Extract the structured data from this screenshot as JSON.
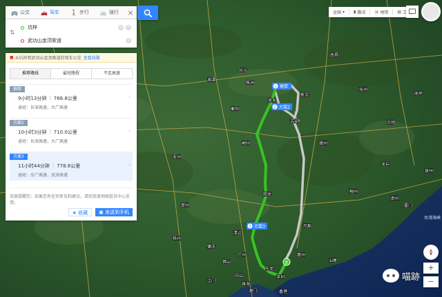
{
  "modebar": {
    "modes": [
      {
        "label": "公交",
        "icon": "bus-icon"
      },
      {
        "label": "驾车",
        "icon": "car-icon"
      },
      {
        "label": "步行",
        "icon": "walk-icon"
      },
      {
        "label": "骑行",
        "icon": "bike-icon"
      }
    ],
    "close": "×"
  },
  "route_inputs": {
    "start": "坑梓",
    "end": "武功山金顶索道",
    "swap_icon": "swap-icon"
  },
  "results": {
    "warning_text": "从坑梓到武功山金顶索道的驾车公交",
    "warning_link": "查看线路",
    "tabs": [
      "推荐路线",
      "最短路程",
      "不走高速"
    ],
    "routes": [
      {
        "label": "推荐",
        "time": "9小时13分钟",
        "distance": "768.8公里",
        "via": "途经：长深高速，大广高速"
      },
      {
        "label": "方案2",
        "time": "10小时3分钟",
        "distance": "710.0公里",
        "via": "途经：长深高速，大广高速"
      },
      {
        "label": "方案3",
        "time": "11小时44分钟",
        "distance": "778.8公里",
        "via": "途经：乐广高速，武深高速"
      }
    ],
    "tip": "百度提醒您：如果您有任何意见和建议，请到百度地图投诉中心反馈。",
    "favorite_label": "收藏",
    "send_label": "发送到手机"
  },
  "toolbar": {
    "city": "全国",
    "layer": "路况",
    "subway": "地铁",
    "tools": "工具"
  },
  "map": {
    "cities": [
      "南昌",
      "长沙",
      "株洲",
      "衡阳",
      "赣州",
      "郴州",
      "韶关",
      "清远",
      "广州",
      "东莞",
      "深圳",
      "香港",
      "澳门",
      "惠州",
      "河源",
      "梅州",
      "龙岩",
      "吉安",
      "萍乡",
      "湘潭",
      "永州",
      "桂林",
      "柳州",
      "贺州",
      "梧州",
      "肇庆",
      "佛山",
      "中山",
      "珠海",
      "江门",
      "汕尾",
      "漳州",
      "厦门",
      "三明",
      "抚州",
      "宜春",
      "新余",
      "南平",
      "泉州"
    ],
    "markers": [
      {
        "num": "1",
        "label": "推荐"
      },
      {
        "num": "2",
        "label": "方案2"
      },
      {
        "num": "3",
        "label": "方案3"
      }
    ],
    "start_marker": "起",
    "sea_label": "台湾海峡"
  },
  "watermark": "喵跡",
  "colors": {
    "accent": "#3385ff",
    "route_primary": "#35c424",
    "route_alt": "#c8c8c8"
  }
}
